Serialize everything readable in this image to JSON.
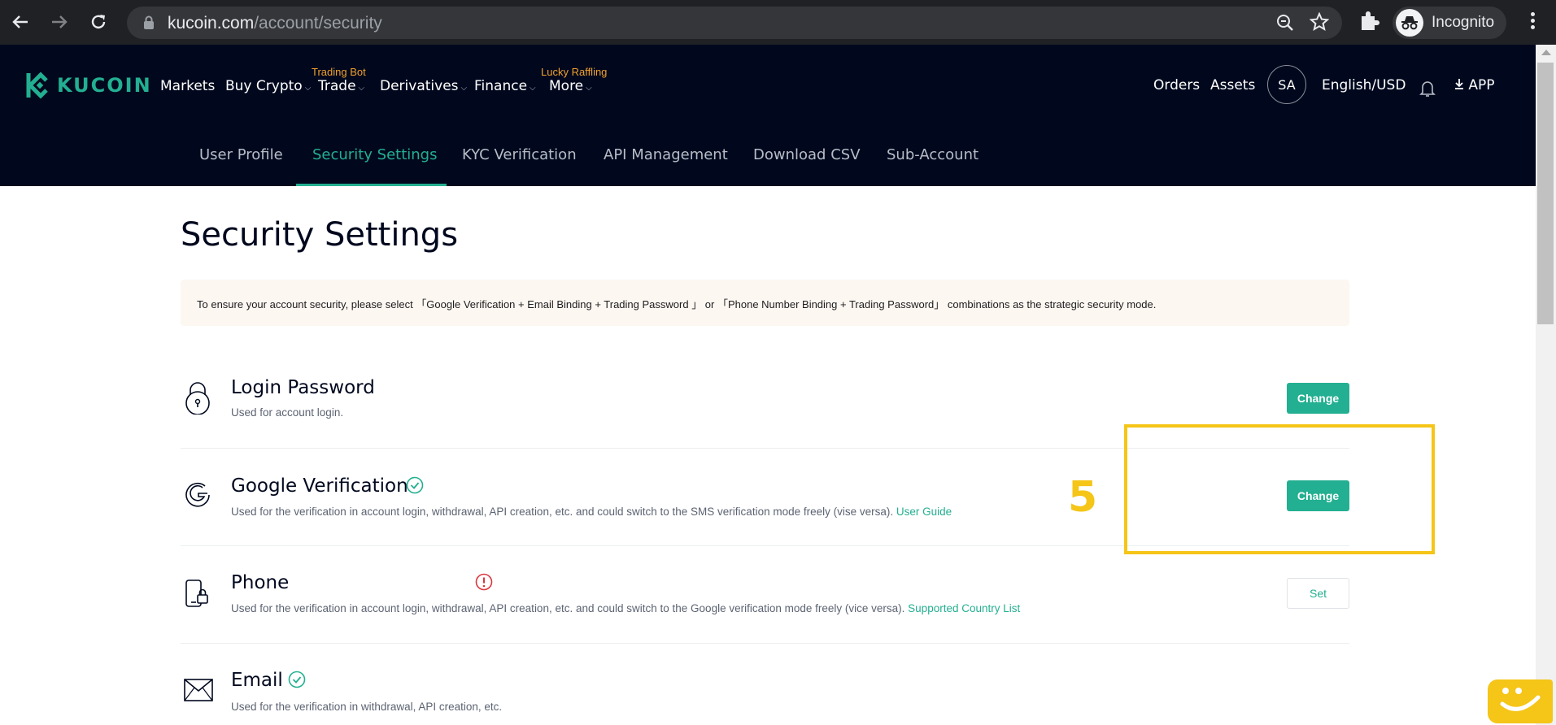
{
  "browser": {
    "url_domain": "kucoin.com",
    "url_path": "/account/security",
    "profile_label": "Incognito"
  },
  "site": {
    "logo_text": "KUCOIN",
    "nav": {
      "markets": "Markets",
      "buy_crypto": "Buy Crypto",
      "trade": "Trade",
      "trade_promo": "Trading Bot",
      "derivatives": "Derivatives",
      "finance": "Finance",
      "more": "More",
      "more_promo": "Lucky Raffling"
    },
    "right_nav": {
      "orders": "Orders",
      "assets": "Assets",
      "avatar_initials": "SA",
      "language": "English/USD",
      "app": "APP"
    },
    "subnav": {
      "user_profile": "User Profile",
      "security_settings": "Security Settings",
      "kyc": "KYC Verification",
      "api": "API Management",
      "csv": "Download CSV",
      "sub_account": "Sub-Account"
    }
  },
  "main": {
    "title": "Security Settings",
    "notice": "To ensure your account security, please select 「Google Verification + Email Binding + Trading Password 」 or 「Phone Number Binding + Trading Password」 combinations as the strategic security mode.",
    "rows": [
      {
        "title": "Login Password",
        "desc": "Used for account login.",
        "link": "",
        "button": "Change",
        "status": "none"
      },
      {
        "title": "Google Verification",
        "desc": "Used for the verification in account login, withdrawal, API creation, etc. and could switch to the SMS verification mode freely (vise versa).",
        "link": "User Guide",
        "button": "Change",
        "status": "verified"
      },
      {
        "title": "Phone",
        "desc": "Used for the verification in account login, withdrawal, API creation, etc. and could switch to the Google verification mode freely (vice versa).",
        "link": "Supported Country List",
        "button": "Set",
        "status": "warning"
      },
      {
        "title": "Email",
        "desc": "Used for the verification in withdrawal, API creation, etc.",
        "link": "",
        "button": "",
        "status": "verified"
      }
    ]
  },
  "annotation": {
    "number": "5",
    "color": "#f5c518"
  },
  "colors": {
    "brand": "#23af91",
    "header_bg": "#01081e",
    "promo": "#f0a12c",
    "warning": "#d9363e"
  }
}
